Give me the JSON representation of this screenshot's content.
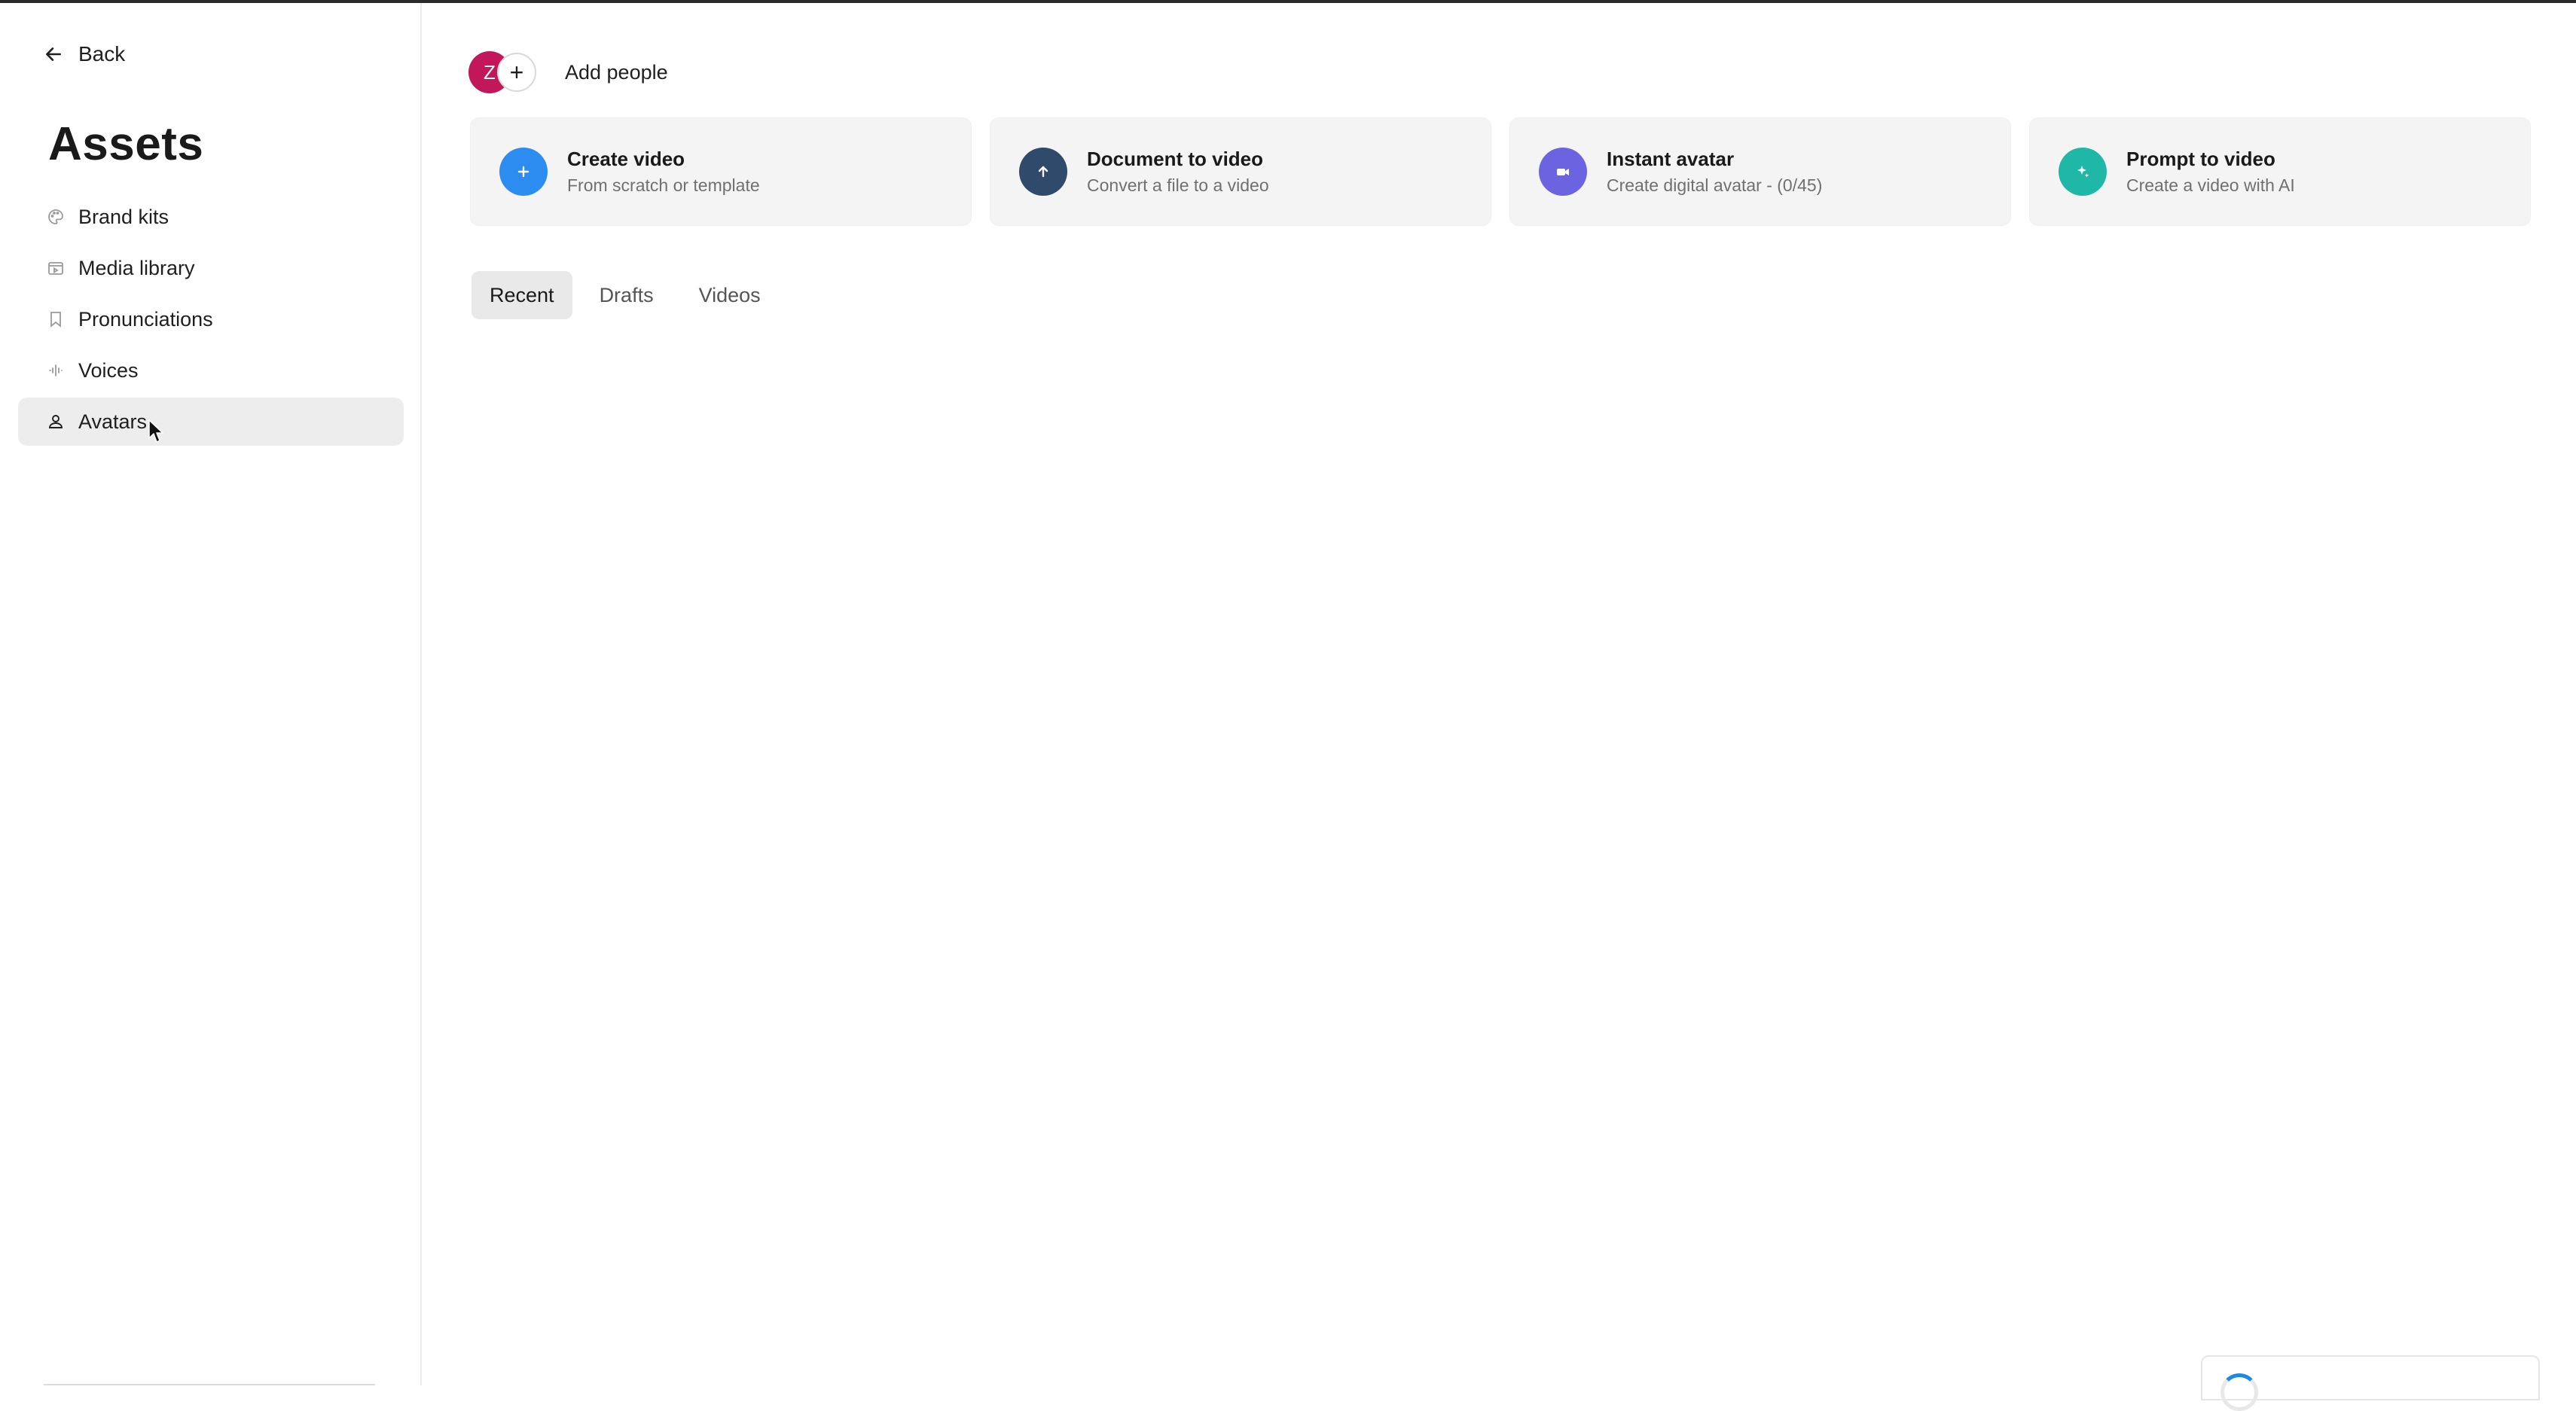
{
  "sidebar": {
    "back_label": "Back",
    "title": "Assets",
    "items": [
      {
        "label": "Brand kits",
        "icon": "palette-icon"
      },
      {
        "label": "Media library",
        "icon": "media-icon"
      },
      {
        "label": "Pronunciations",
        "icon": "bookmark-icon"
      },
      {
        "label": "Voices",
        "icon": "waveform-icon"
      },
      {
        "label": "Avatars",
        "icon": "person-icon",
        "active": true
      }
    ]
  },
  "header": {
    "avatar_initial": "Z",
    "avatar_color": "#c2185b",
    "add_people_label": "Add people"
  },
  "cards": [
    {
      "title": "Create video",
      "subtitle": "From scratch or template",
      "icon": "plus-icon",
      "color": "#2d8cf0"
    },
    {
      "title": "Document to video",
      "subtitle": "Convert a file to a video",
      "icon": "arrow-up-icon",
      "color": "#2f4a6b"
    },
    {
      "title": "Instant avatar",
      "subtitle": "Create digital avatar - (0/45)",
      "icon": "video-camera-icon",
      "color": "#6c63e0"
    },
    {
      "title": "Prompt to video",
      "subtitle": "Create a video with AI",
      "icon": "sparkle-icon",
      "color": "#1fb8a6"
    }
  ],
  "tabs": [
    {
      "label": "Recent",
      "active": true
    },
    {
      "label": "Drafts"
    },
    {
      "label": "Videos"
    }
  ]
}
